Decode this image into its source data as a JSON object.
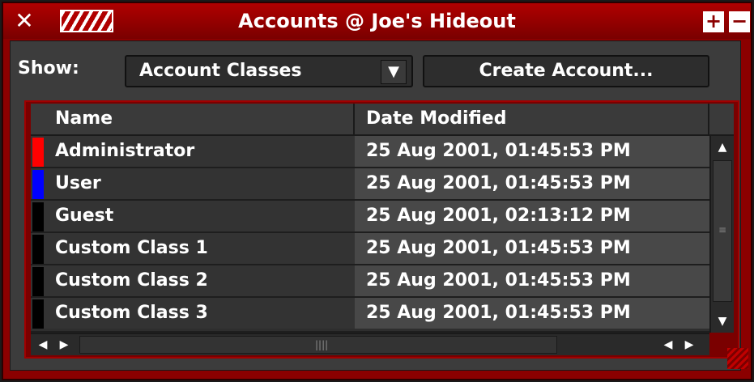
{
  "window": {
    "title": "Accounts @ Joe's Hideout"
  },
  "toolbar": {
    "show_label": "Show:",
    "show_select_value": "Account Classes",
    "create_button": "Create Account..."
  },
  "table": {
    "columns": [
      "Name",
      "Date Modified"
    ],
    "rows": [
      {
        "name": "Administrator",
        "date": "25 Aug 2001, 01:45:53 PM",
        "color": "#ff0000"
      },
      {
        "name": "User",
        "date": "25 Aug 2001, 01:45:53 PM",
        "color": "#0000ff"
      },
      {
        "name": "Guest",
        "date": "25 Aug 2001, 02:13:12 PM",
        "color": "#000000"
      },
      {
        "name": "Custom Class 1",
        "date": "25 Aug 2001, 01:45:53 PM",
        "color": "#000000"
      },
      {
        "name": "Custom Class 2",
        "date": "25 Aug 2001, 01:45:53 PM",
        "color": "#000000"
      },
      {
        "name": "Custom Class 3",
        "date": "25 Aug 2001, 01:45:53 PM",
        "color": "#000000"
      }
    ]
  },
  "icons": {
    "close": "close-icon",
    "menu": "hatch-menu-icon",
    "maximize": "plus-icon",
    "minimize": "minus-icon"
  }
}
